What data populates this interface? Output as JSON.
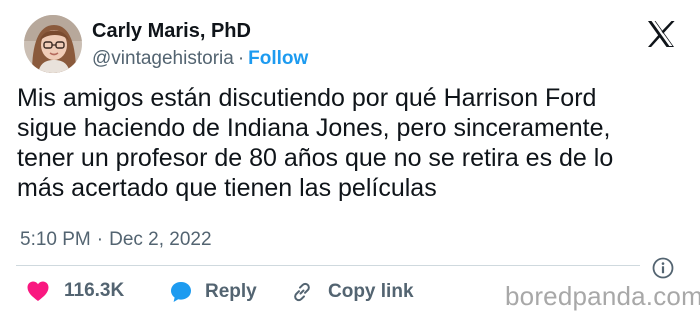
{
  "author": {
    "name": "Carly Maris, PhD",
    "handle": "@vintagehistoria",
    "separator": "·",
    "follow_label": "Follow"
  },
  "post": {
    "lines": [
      "Mis amigos están discutiendo por qué Harrison Ford",
      "sigue haciendo de Indiana Jones, pero sinceramente,",
      "tener un profesor de 80 años que  no se retira es de lo",
      "más acertado que tienen las películas"
    ],
    "time": "5:10 PM",
    "date_separator": "·",
    "date": "Dec 2, 2022"
  },
  "actions": {
    "likes": "116.3K",
    "reply_label": "Reply",
    "copy_link_label": "Copy link"
  },
  "watermark": "boredpanda.com",
  "icons": {
    "brand": "x-logo-icon",
    "info": "info-icon",
    "like": "heart-icon",
    "reply": "speech-bubble-icon",
    "copy": "link-icon"
  },
  "colors": {
    "accent": "#1d9bf0",
    "heart": "#f91880",
    "text": "#0f1419",
    "muted": "#536471"
  }
}
